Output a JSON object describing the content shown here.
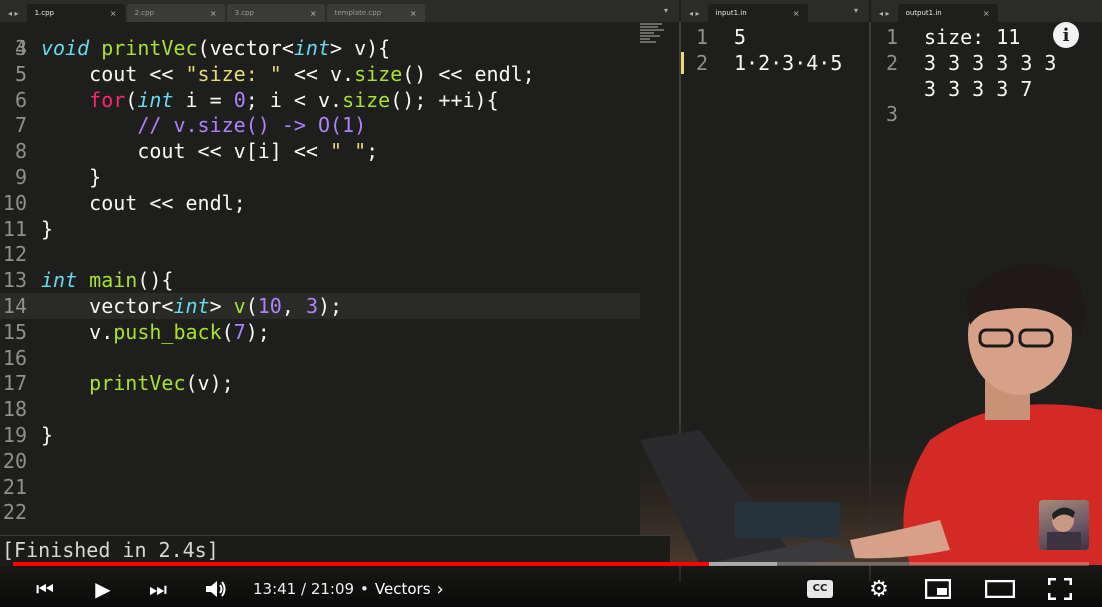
{
  "tabs": {
    "main": [
      {
        "label": "1.cpp",
        "active": true
      },
      {
        "label": "2.cpp",
        "active": false
      },
      {
        "label": "3.cpp",
        "active": false
      },
      {
        "label": "template.cpp",
        "active": false
      }
    ],
    "input": {
      "label": "input1.in"
    },
    "output": {
      "label": "output1.in"
    },
    "close_glyph": "×",
    "nav_glyph": "◂ ▸",
    "dropdown_glyph": "▾"
  },
  "editor": {
    "partial_top_number": "3",
    "lines": [
      {
        "n": "4",
        "tokens": [
          [
            "kw-t",
            "void"
          ],
          [
            "pl",
            " "
          ],
          [
            "fn",
            "printVec"
          ],
          [
            "pl",
            "(vector<"
          ],
          [
            "kw-t",
            "int"
          ],
          [
            "pl",
            "> v){"
          ]
        ]
      },
      {
        "n": "5",
        "tokens": [
          [
            "pl",
            "    cout << "
          ],
          [
            "str",
            "\"size: \""
          ],
          [
            "pl",
            " << v."
          ],
          [
            "fn",
            "size"
          ],
          [
            "pl",
            "() << endl;"
          ]
        ]
      },
      {
        "n": "6",
        "tokens": [
          [
            "pl",
            "    "
          ],
          [
            "ctl",
            "for"
          ],
          [
            "pl",
            "("
          ],
          [
            "kw-t",
            "int"
          ],
          [
            "pl",
            " i = "
          ],
          [
            "num",
            "0"
          ],
          [
            "pl",
            "; i < v."
          ],
          [
            "fn",
            "size"
          ],
          [
            "pl",
            "(); ++i){"
          ]
        ]
      },
      {
        "n": "7",
        "tokens": [
          [
            "cmt",
            "        // v.size() -> O(1)"
          ]
        ]
      },
      {
        "n": "8",
        "tokens": [
          [
            "pl",
            "        cout << v[i] << "
          ],
          [
            "str",
            "\" \""
          ],
          [
            "pl",
            ";"
          ]
        ]
      },
      {
        "n": "9",
        "tokens": [
          [
            "pl",
            "    }"
          ]
        ]
      },
      {
        "n": "10",
        "tokens": [
          [
            "pl",
            "    cout << endl;"
          ]
        ]
      },
      {
        "n": "11",
        "tokens": [
          [
            "pl",
            "}"
          ]
        ]
      },
      {
        "n": "12",
        "tokens": []
      },
      {
        "n": "13",
        "tokens": [
          [
            "kw-t",
            "int"
          ],
          [
            "pl",
            " "
          ],
          [
            "fn",
            "main"
          ],
          [
            "pl",
            "(){"
          ]
        ]
      },
      {
        "n": "14",
        "tokens": [
          [
            "pl",
            "    vector<"
          ],
          [
            "kw-t",
            "int"
          ],
          [
            "pl",
            "> "
          ],
          [
            "fn",
            "v"
          ],
          [
            "pl",
            "("
          ],
          [
            "num",
            "10"
          ],
          [
            "pl",
            ", "
          ],
          [
            "num",
            "3"
          ],
          [
            "pl",
            ");"
          ]
        ]
      },
      {
        "n": "15",
        "tokens": [
          [
            "pl",
            "    v."
          ],
          [
            "fn",
            "push_back"
          ],
          [
            "pl",
            "("
          ],
          [
            "num",
            "7"
          ],
          [
            "pl",
            ");"
          ]
        ]
      },
      {
        "n": "16",
        "tokens": []
      },
      {
        "n": "17",
        "tokens": [
          [
            "pl",
            "    "
          ],
          [
            "fn",
            "printVec"
          ],
          [
            "pl",
            "(v);"
          ]
        ]
      },
      {
        "n": "18",
        "tokens": []
      },
      {
        "n": "19",
        "tokens": [
          [
            "pl",
            "}"
          ]
        ]
      },
      {
        "n": "20",
        "tokens": []
      },
      {
        "n": "21",
        "tokens": []
      },
      {
        "n": "22",
        "tokens": []
      }
    ]
  },
  "input_pane": {
    "lines": [
      {
        "n": "1",
        "text": "5"
      },
      {
        "n": "2",
        "text": "1·2·3·4·5"
      }
    ]
  },
  "output_pane": {
    "lines": [
      {
        "n": "1",
        "text": "size: 11"
      },
      {
        "n": "2",
        "text": "3 3 3 3 3 3"
      },
      {
        "n": "",
        "text": "3 3 3 3 7"
      },
      {
        "n": "3",
        "text": ""
      }
    ]
  },
  "build": {
    "text": "[Finished in 2.4s]"
  },
  "player": {
    "time": "13:41 / 21:09",
    "separator": "•",
    "chapter": "Vectors",
    "chapter_arrow": "›",
    "progress_played": 0.647,
    "progress_buffered": 0.71,
    "info_glyph": "i",
    "cc_label": "CC",
    "icons": {
      "prev": "⏮",
      "play": "▶",
      "next": "⏭",
      "volume": "🔊",
      "settings": "⚙",
      "miniplayer": "▣",
      "theater": "▭",
      "fullscreen": "⛶"
    }
  }
}
